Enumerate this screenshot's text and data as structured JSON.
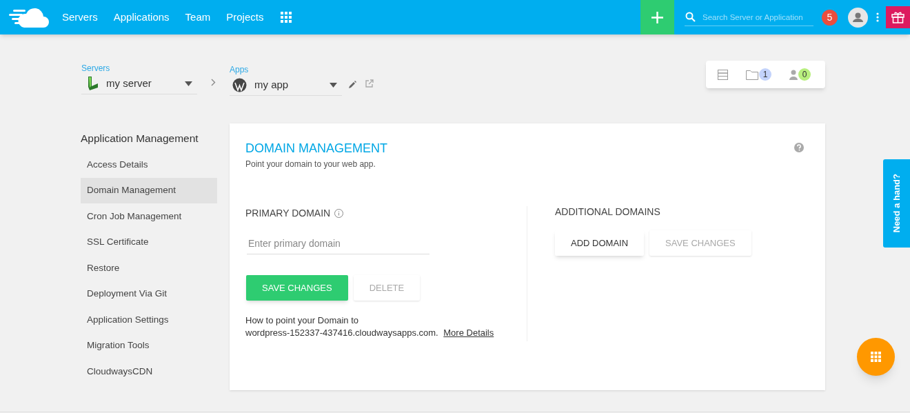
{
  "nav": {
    "links": [
      "Servers",
      "Applications",
      "Team",
      "Projects"
    ],
    "search": {
      "placeholder": "Search Server or Application"
    },
    "notifications": "5"
  },
  "breadcrumb": {
    "server": {
      "label": "Servers",
      "value": "my server"
    },
    "app": {
      "label": "Apps",
      "value": "my app"
    }
  },
  "summary": {
    "projects_count": "1",
    "team_count": "0"
  },
  "sidebar": {
    "title": "Application Management",
    "items": [
      {
        "label": "Access Details",
        "selected": false
      },
      {
        "label": "Domain Management",
        "selected": true
      },
      {
        "label": "Cron Job Management",
        "selected": false
      },
      {
        "label": "SSL Certificate",
        "selected": false
      },
      {
        "label": "Restore",
        "selected": false
      },
      {
        "label": "Deployment Via Git",
        "selected": false
      },
      {
        "label": "Application Settings",
        "selected": false
      },
      {
        "label": "Migration Tools",
        "selected": false
      },
      {
        "label": "CloudwaysCDN",
        "selected": false
      }
    ]
  },
  "panel": {
    "title": "DOMAIN MANAGEMENT",
    "subtitle": "Point your domain to your web app.",
    "primary": {
      "heading": "PRIMARY DOMAIN",
      "placeholder": "Enter primary domain",
      "buttons": [
        {
          "label": "SAVE CHANGES",
          "kind": "primary",
          "disabled": false
        },
        {
          "label": "DELETE",
          "kind": "plain",
          "disabled": true
        }
      ],
      "help_lines": [
        "How to point your Domain to",
        "wordpress-152337-437416.cloudwaysapps.com."
      ],
      "help_link": "More Details"
    },
    "additional": {
      "heading": "ADDITIONAL DOMAINS",
      "buttons": [
        {
          "label": "ADD DOMAIN",
          "kind": "plain",
          "disabled": false
        },
        {
          "label": "SAVE CHANGES",
          "kind": "plain",
          "disabled": true
        }
      ]
    }
  },
  "help_tab": "Need a hand?"
}
